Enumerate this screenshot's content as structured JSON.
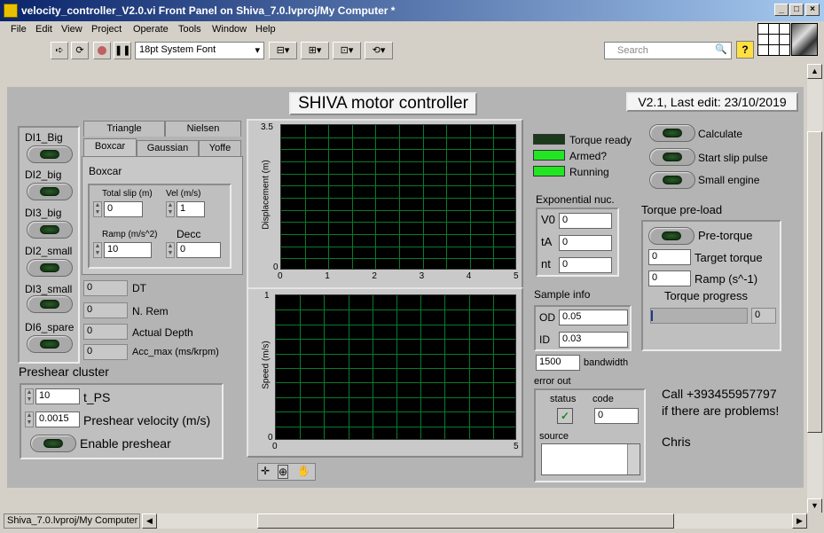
{
  "window": {
    "title": "velocity_controller_V2.0.vi Front Panel on Shiva_7.0.lvproj/My Computer *"
  },
  "menu": [
    "File",
    "Edit",
    "View",
    "Project",
    "Operate",
    "Tools",
    "Window",
    "Help"
  ],
  "toolbar": {
    "font": "18pt System Font",
    "search_placeholder": "Search"
  },
  "panel": {
    "title": "SHIVA motor controller",
    "version": "V2.1, Last edit: 23/10/2019"
  },
  "di": [
    "DI1_Big",
    "DI2_big",
    "DI3_big",
    "DI2_small",
    "DI3_small",
    "DI6_spare"
  ],
  "tabs": {
    "row1": [
      "Triangle",
      "Nielsen"
    ],
    "row2": [
      "Boxcar",
      "Gaussian",
      "Yoffe"
    ],
    "content_title": "Boxcar",
    "total_slip_label": "Total slip (m)",
    "total_slip": "0",
    "vel_label": "Vel (m/s)",
    "vel": "1",
    "ramp_label": "Ramp (m/s^2)",
    "ramp": "10",
    "decc_label": "Decc",
    "decc": "0"
  },
  "outputs": [
    {
      "label": "DT",
      "value": "0"
    },
    {
      "label": "N. Rem",
      "value": "0"
    },
    {
      "label": "Actual Depth",
      "value": "0"
    },
    {
      "label": "Acc_max (ms/krpm)",
      "value": "0"
    }
  ],
  "preshear": {
    "title": "Preshear cluster",
    "t_ps_label": "t_PS",
    "t_ps": "10",
    "vel_label": "Preshear velocity (m/s)",
    "vel": "0.0015",
    "enable_label": "Enable preshear"
  },
  "chart_data": [
    {
      "type": "line",
      "title": "",
      "xlabel": "",
      "ylabel": "Displacement (m)",
      "xlim": [
        0,
        5
      ],
      "ylim": [
        0,
        3.5
      ],
      "x_ticks": [
        "0",
        "1",
        "2",
        "3",
        "4",
        "5"
      ],
      "y_ticks": [
        "0",
        "3.5"
      ],
      "grid": true,
      "series": []
    },
    {
      "type": "line",
      "title": "",
      "xlabel": "",
      "ylabel": "Speed (m/s)",
      "xlim": [
        0,
        5
      ],
      "ylim": [
        0,
        1
      ],
      "x_ticks": [
        "0",
        "5"
      ],
      "y_ticks": [
        "0",
        "1"
      ],
      "grid": true,
      "series": []
    }
  ],
  "status_leds": [
    {
      "label": "Torque ready",
      "on": false
    },
    {
      "label": "Armed?",
      "on": true
    },
    {
      "label": "Running",
      "on": true
    }
  ],
  "exp_nuc": {
    "title": "Exponential nuc.",
    "rows": [
      {
        "label": "V0",
        "value": "0"
      },
      {
        "label": "tA",
        "value": "0"
      },
      {
        "label": "nt",
        "value": "0"
      }
    ]
  },
  "sample_info": {
    "title": "Sample info",
    "od_label": "OD",
    "od": "0.05",
    "id_label": "ID",
    "id": "0.03"
  },
  "bandwidth": {
    "value": "1500",
    "label": "bandwidth"
  },
  "error_out": {
    "title": "error out",
    "status_label": "status",
    "code_label": "code",
    "code": "0",
    "source_label": "source"
  },
  "actions": [
    "Calculate",
    "Start slip pulse",
    "Small engine"
  ],
  "torque": {
    "title": "Torque pre-load",
    "pretorque_label": "Pre-torque",
    "target_label": "Target torque",
    "target": "0",
    "ramp_label": "Ramp (s^-1)",
    "ramp": "0",
    "progress_label": "Torque progress",
    "progress": "0",
    "progress_fraction": 0.0
  },
  "contact": {
    "line1": "Call +393455957797",
    "line2": "if there are problems!",
    "name": "Chris"
  },
  "statusbar": {
    "path": "Shiva_7.0.lvproj/My Computer"
  },
  "colors": {
    "led_on": "#22e622",
    "led_off": "#1a3a1a",
    "grid": "#0a7a2a"
  }
}
